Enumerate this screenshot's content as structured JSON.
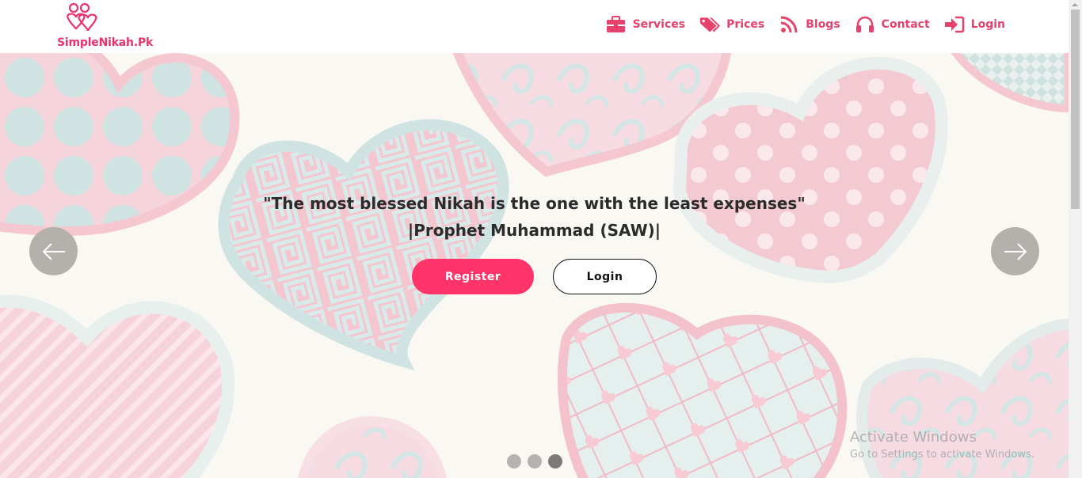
{
  "header": {
    "logo_text": "SimpleNikah.Pk",
    "nav": [
      {
        "label": "Services",
        "icon": "briefcase-icon"
      },
      {
        "label": "Prices",
        "icon": "tags-icon"
      },
      {
        "label": "Blogs",
        "icon": "rss-feed-icon"
      },
      {
        "label": "Contact",
        "icon": "headphones-icon"
      },
      {
        "label": "Login",
        "icon": "sign-in-icon"
      }
    ]
  },
  "hero": {
    "quote_line1": "\"The most blessed Nikah is the one with the least expenses\"",
    "quote_line2": "|Prophet Muhammad (SAW)|",
    "register_label": "Register",
    "login_label": "Login",
    "slides_total": 3,
    "active_slide": 3
  },
  "watermark": {
    "title": "Activate Windows",
    "subtitle": "Go to Settings to activate Windows."
  },
  "colors": {
    "brand_pink": "#e7426c",
    "register_button": "#ff3469",
    "hero_background": "#faf8f2"
  }
}
